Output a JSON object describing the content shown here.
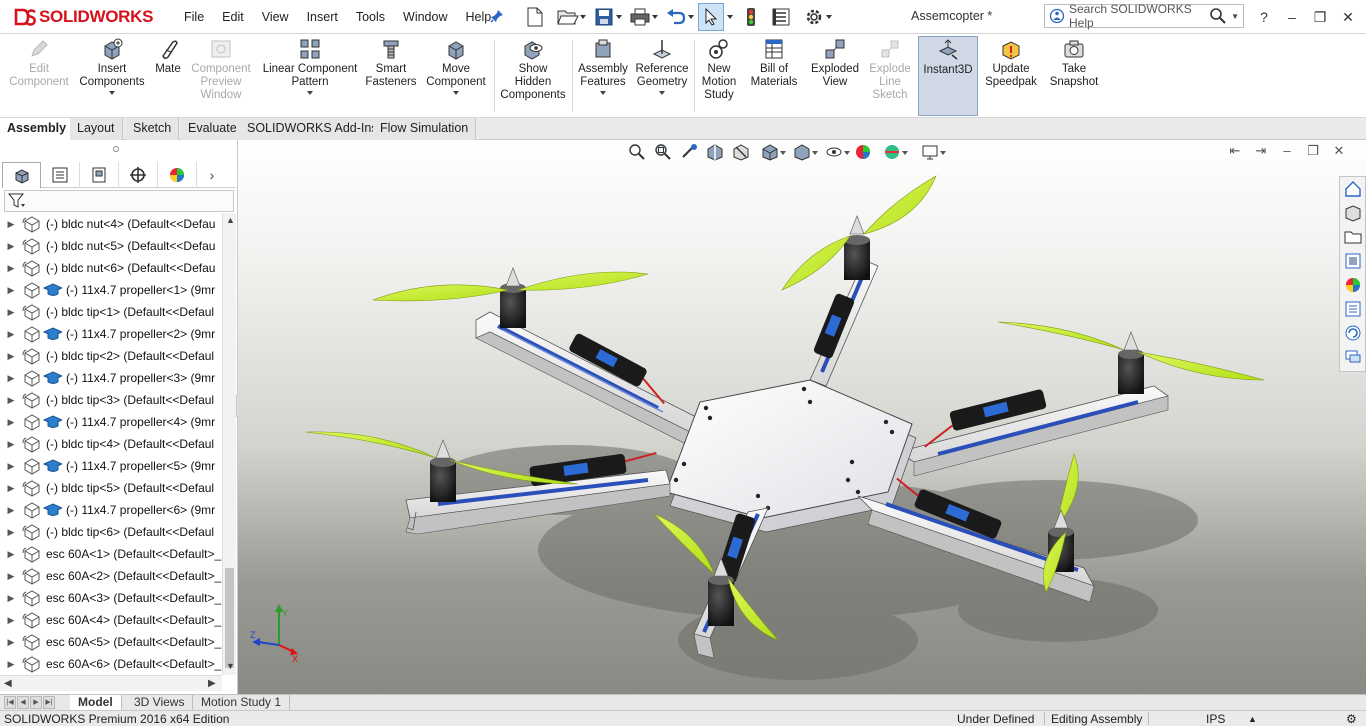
{
  "app": {
    "brand_prefix": "S",
    "brand_main": "SOLIDWORKS",
    "document_title": "Assemcopter *",
    "search_placeholder": "Search SOLIDWORKS Help"
  },
  "menu": [
    "File",
    "Edit",
    "View",
    "Insert",
    "Tools",
    "Window",
    "Help"
  ],
  "quick_access_icons": [
    "new-document-icon",
    "open-icon",
    "save-icon",
    "print-icon",
    "undo-icon",
    "select-icon",
    "rebuild-icon",
    "file-properties-icon",
    "options-icon"
  ],
  "command_manager": [
    {
      "label": "Edit\nComponent",
      "icon": "edit-component-icon",
      "disabled": true
    },
    {
      "label": "Insert\nComponents",
      "icon": "insert-components-icon",
      "disabled": false
    },
    {
      "label": "Mate",
      "icon": "mate-icon",
      "disabled": false
    },
    {
      "label": "Component\nPreview\nWindow",
      "icon": "component-preview-icon",
      "disabled": true
    },
    {
      "label": "Linear Component\nPattern",
      "icon": "linear-pattern-icon",
      "disabled": false
    },
    {
      "label": "Smart\nFasteners",
      "icon": "smart-fasteners-icon",
      "disabled": false
    },
    {
      "label": "Move\nComponent",
      "icon": "move-component-icon",
      "disabled": false
    },
    {
      "label": "Show\nHidden\nComponents",
      "icon": "show-hidden-icon",
      "disabled": false
    },
    {
      "label": "Assembly\nFeatures",
      "icon": "assembly-features-icon",
      "disabled": false
    },
    {
      "label": "Reference\nGeometry",
      "icon": "reference-geometry-icon",
      "disabled": false
    },
    {
      "label": "New\nMotion\nStudy",
      "icon": "motion-study-icon",
      "disabled": false
    },
    {
      "label": "Bill of\nMaterials",
      "icon": "bill-of-materials-icon",
      "disabled": false
    },
    {
      "label": "Exploded\nView",
      "icon": "exploded-view-icon",
      "disabled": false
    },
    {
      "label": "Explode\nLine\nSketch",
      "icon": "explode-line-sketch-icon",
      "disabled": true
    },
    {
      "label": "Instant3D",
      "icon": "instant3d-icon",
      "disabled": false,
      "active": true
    },
    {
      "label": "Update\nSpeedpak",
      "icon": "speedpak-icon",
      "disabled": false
    },
    {
      "label": "Take\nSnapshot",
      "icon": "snapshot-icon",
      "disabled": false
    }
  ],
  "command_tabs": [
    "Assembly",
    "Layout",
    "Sketch",
    "Evaluate",
    "SOLIDWORKS Add-Ins",
    "Flow Simulation"
  ],
  "feature_tree": [
    {
      "label": "(-) bldc nut<4> (Default<<Defau",
      "type": "part"
    },
    {
      "label": "(-) bldc nut<5> (Default<<Defau",
      "type": "part"
    },
    {
      "label": "(-) bldc nut<6> (Default<<Defau",
      "type": "part"
    },
    {
      "label": "(-) 11x4.7 propeller<1> (9mr",
      "type": "subassembly"
    },
    {
      "label": "(-) bldc tip<1> (Default<<Defaul",
      "type": "part"
    },
    {
      "label": "(-) 11x4.7 propeller<2> (9mr",
      "type": "subassembly"
    },
    {
      "label": "(-) bldc tip<2> (Default<<Defaul",
      "type": "part"
    },
    {
      "label": "(-) 11x4.7 propeller<3> (9mr",
      "type": "subassembly"
    },
    {
      "label": "(-) bldc tip<3> (Default<<Defaul",
      "type": "part"
    },
    {
      "label": "(-) 11x4.7 propeller<4> (9mr",
      "type": "subassembly"
    },
    {
      "label": "(-) bldc tip<4> (Default<<Defaul",
      "type": "part"
    },
    {
      "label": "(-) 11x4.7 propeller<5> (9mr",
      "type": "subassembly"
    },
    {
      "label": "(-) bldc tip<5> (Default<<Defaul",
      "type": "part"
    },
    {
      "label": "(-) 11x4.7 propeller<6> (9mr",
      "type": "subassembly"
    },
    {
      "label": "(-) bldc tip<6> (Default<<Defaul",
      "type": "part"
    },
    {
      "label": "esc 60A<1> (Default<<Default>_",
      "type": "part"
    },
    {
      "label": "esc 60A<2> (Default<<Default>_",
      "type": "part"
    },
    {
      "label": "esc 60A<3> (Default<<Default>_",
      "type": "part"
    },
    {
      "label": "esc 60A<4> (Default<<Default>_",
      "type": "part"
    },
    {
      "label": "esc 60A<5> (Default<<Default>_",
      "type": "part"
    },
    {
      "label": "esc 60A<6> (Default<<Default>_",
      "type": "part"
    }
  ],
  "bottom_tabs": [
    "Model",
    "3D Views",
    "Motion Study 1"
  ],
  "status": {
    "edition": "SOLIDWORKS Premium 2016 x64 Edition",
    "definition": "Under Defined",
    "mode": "Editing Assembly",
    "units": "IPS"
  },
  "colors": {
    "brand_red": "#d6111b",
    "propeller": "#c9ef2a",
    "arm": "#e7e7e7",
    "plate": "#f2f3f5"
  }
}
